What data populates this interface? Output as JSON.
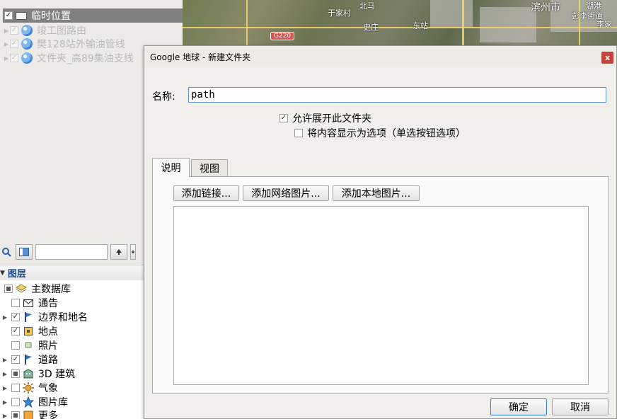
{
  "places": {
    "temp_folder": "临时位置",
    "items": [
      {
        "label": "竣工图路由"
      },
      {
        "label": "樊128站外输油管线"
      },
      {
        "label": "文件夹_高89集油支线"
      }
    ]
  },
  "map": {
    "labels": [
      "于家村",
      "史庄",
      "东站",
      "北马",
      "湖港",
      "滨州市",
      "彭李街道",
      "李家"
    ],
    "road_shield": "G220"
  },
  "layers": {
    "header": "图层",
    "items": [
      {
        "label": "主数据库",
        "icon": "layers-stack-icon",
        "state": "partial"
      },
      {
        "label": "通告",
        "icon": "mail-icon",
        "state": "unchecked"
      },
      {
        "label": "边界和地名",
        "icon": "flag-icon",
        "state": "checked"
      },
      {
        "label": "地点",
        "icon": "square-marker-icon",
        "state": "checked"
      },
      {
        "label": "照片",
        "icon": "photo-icon",
        "state": "unchecked"
      },
      {
        "label": "道路",
        "icon": "flag-icon",
        "state": "checked"
      },
      {
        "label": "3D 建筑",
        "icon": "building-icon",
        "state": "partial"
      },
      {
        "label": "气象",
        "icon": "sun-icon",
        "state": "unchecked"
      },
      {
        "label": "图片库",
        "icon": "star-icon",
        "state": "unchecked"
      },
      {
        "label": "更多",
        "icon": "more-icon",
        "state": "partial"
      }
    ]
  },
  "dialog": {
    "title": "Google 地球 - 新建文件夹",
    "close": "x",
    "name_label": "名称:",
    "name_value": "path",
    "allow_expand": "允许展开此文件夹",
    "show_as_options": "将内容显示为选项（单选按钮选项）",
    "tabs": [
      "说明",
      "视图"
    ],
    "buttons": {
      "add_link": "添加链接...",
      "add_web_image": "添加网络图片...",
      "add_local_image": "添加本地图片..."
    },
    "ok": "确定",
    "cancel": "取消"
  }
}
